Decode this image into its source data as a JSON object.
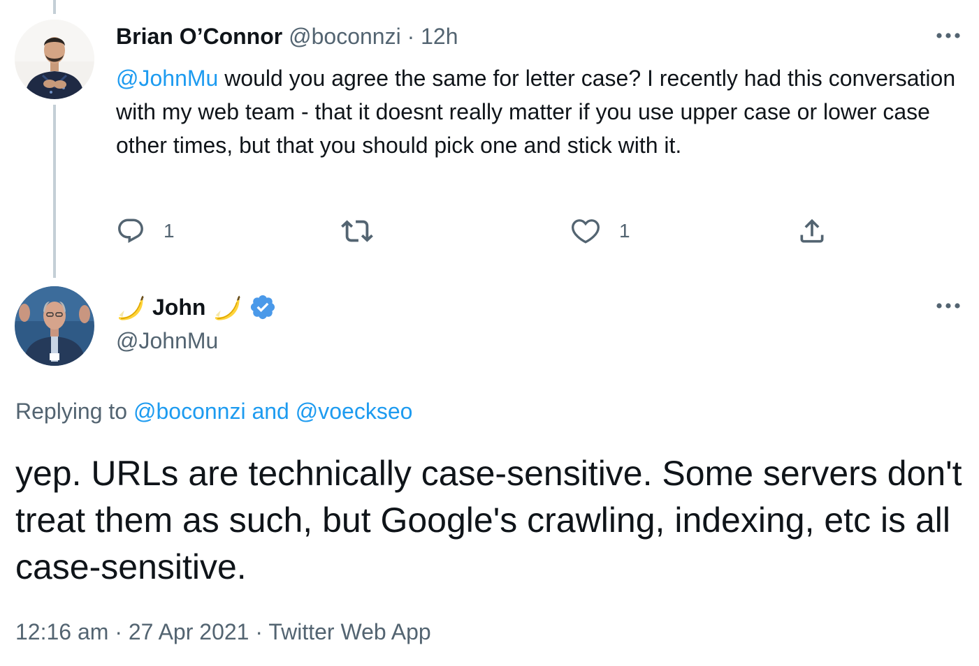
{
  "parent_tweet": {
    "author_name": "Brian O’Connor",
    "author_handle": "@boconnzi",
    "separator": " · ",
    "time": "12h",
    "mention": "@JohnMu",
    "text": " would you agree the same for letter case? I recently had this conversation with my web team - that it doesnt really matter if you use upper case or lower case other times, but that you should pick one and stick with it.",
    "reply_count": "1",
    "retweet_count": "",
    "like_count": "1"
  },
  "reply_tweet": {
    "author_name": "John",
    "author_handle": "@JohnMu",
    "name_decoration_icon": "banana-emoji",
    "verified_icon": "verified-badge-icon",
    "replying_prefix": "Replying to ",
    "replying_to_1": "@boconnzi",
    "replying_joiner": " and ",
    "replying_to_2": "@voeckseo",
    "text": "yep. URLs are technically case-sensitive. Some servers don't treat them as such, but Google's crawling, indexing, etc is all case-sensitive.",
    "time": "12:16 am",
    "separator": " · ",
    "date": "27 Apr 2021",
    "source": "Twitter Web App"
  },
  "colors": {
    "accent": "#1d9bf0",
    "text_primary": "#0f1419",
    "text_secondary": "#536471",
    "thread_line": "#c4cfd6"
  }
}
